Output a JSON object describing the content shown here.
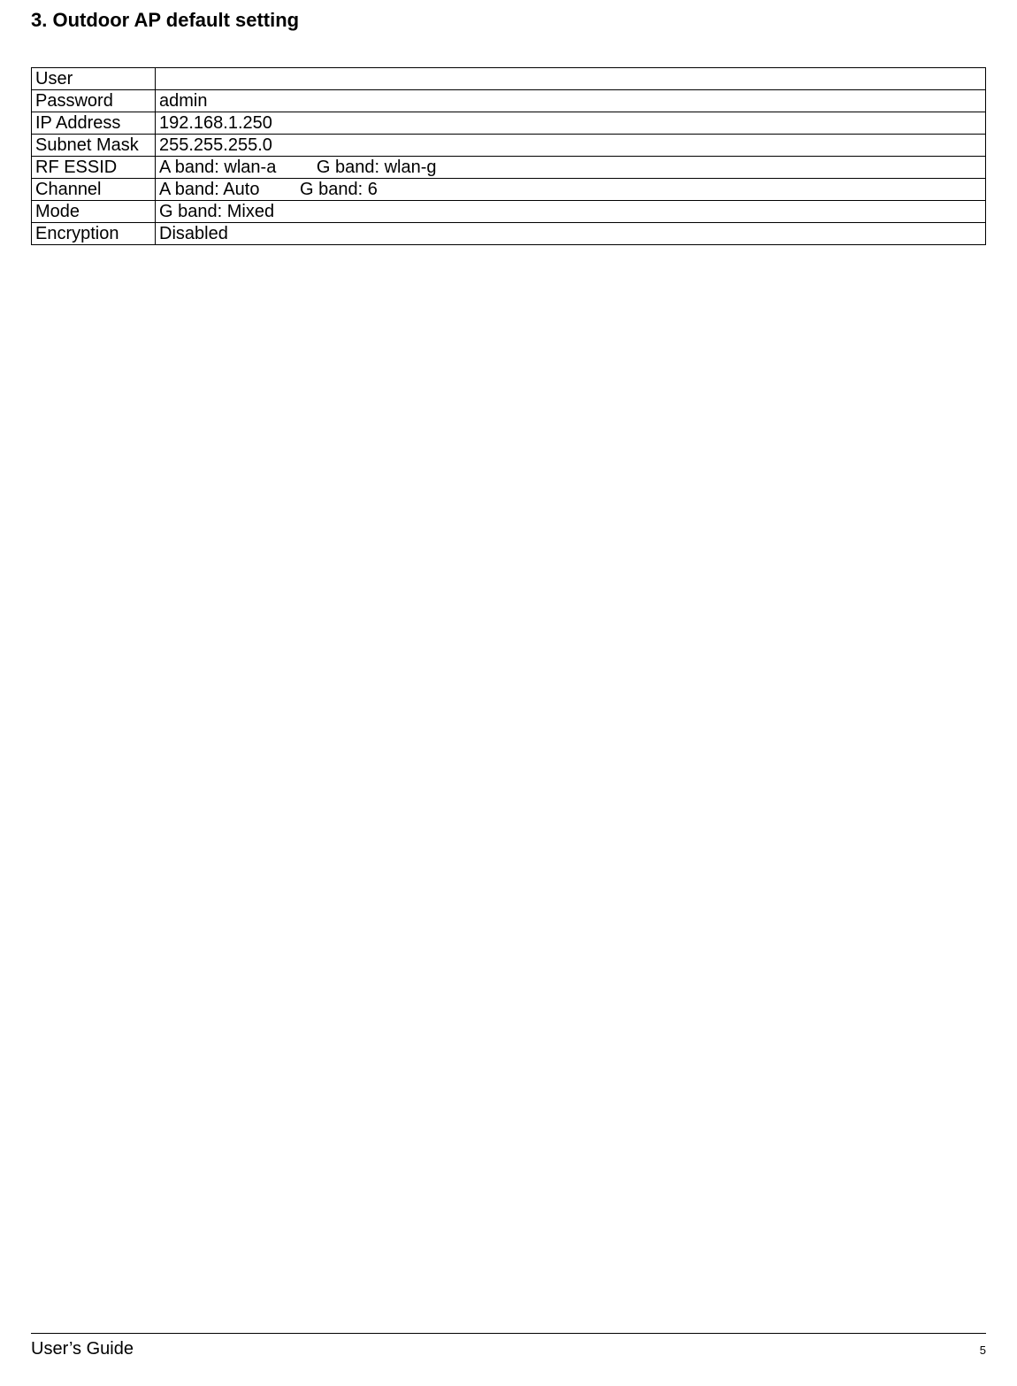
{
  "heading": "3. Outdoor AP default setting",
  "table": {
    "rows": [
      {
        "label": "User",
        "value": ""
      },
      {
        "label": "Password",
        "value": "admin"
      },
      {
        "label": "IP Address",
        "value": "192.168.1.250"
      },
      {
        "label": "Subnet Mask",
        "value": "255.255.255.0"
      },
      {
        "label": "RF ESSID",
        "value_a": "A band: wlan-a",
        "value_b": "G band: wlan-g"
      },
      {
        "label": "Channel",
        "value_a": "A band: Auto",
        "value_b": "G band: 6"
      },
      {
        "label": "Mode",
        "value": "G band: Mixed"
      },
      {
        "label": "Encryption",
        "value": "Disabled"
      }
    ]
  },
  "footer": {
    "title": "User’s Guide",
    "page": "5"
  }
}
